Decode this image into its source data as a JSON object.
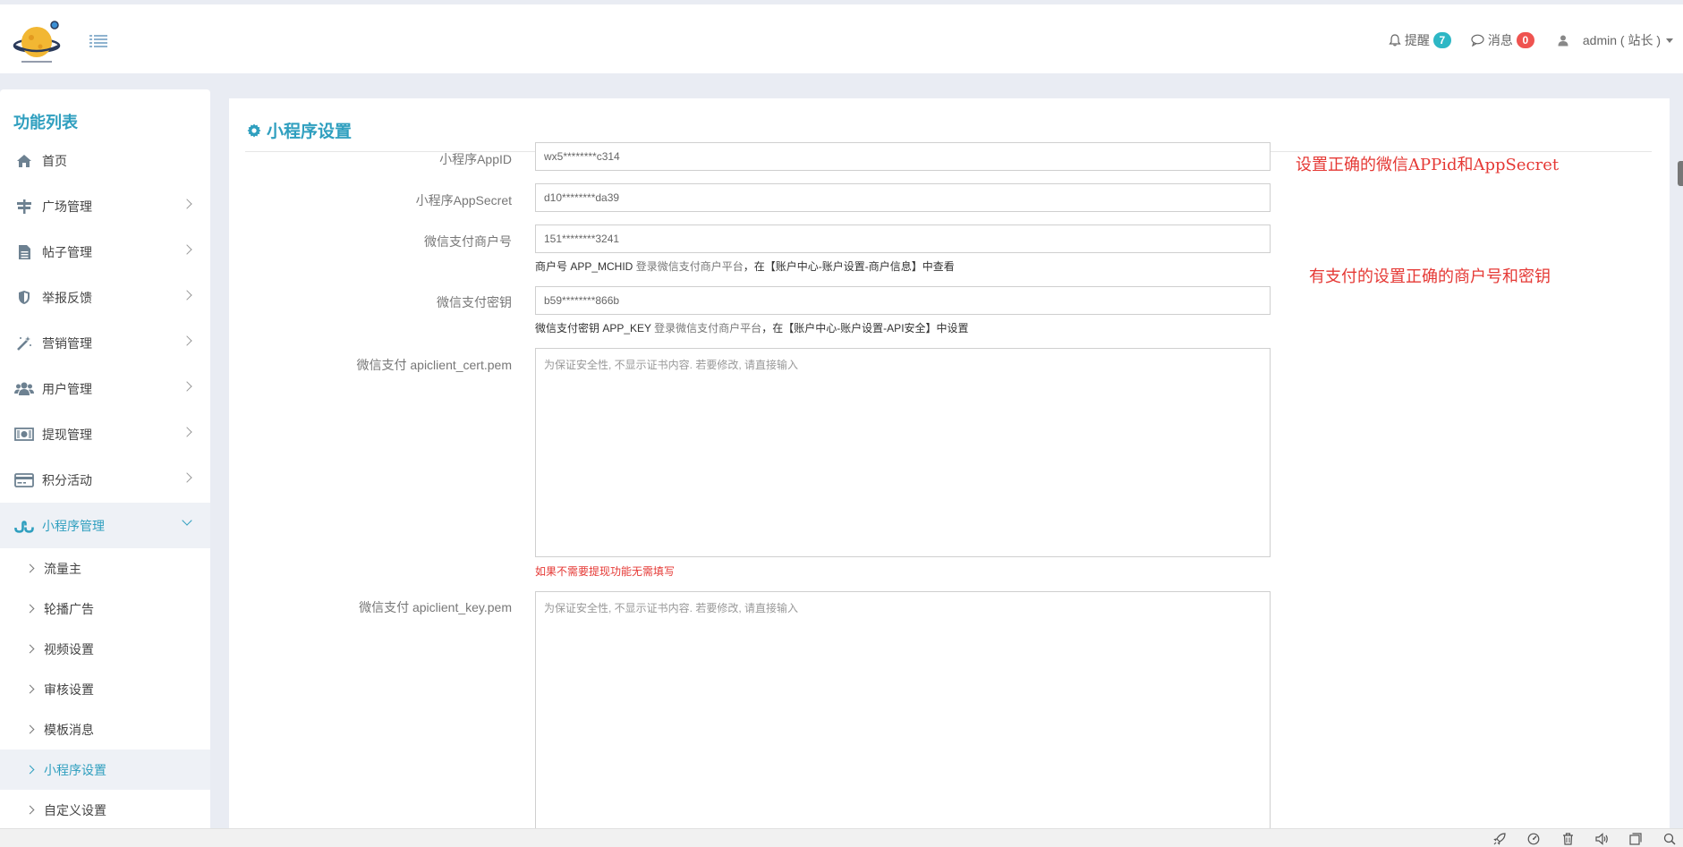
{
  "header": {
    "reminder_label": "提醒",
    "reminder_count": "7",
    "message_label": "消息",
    "message_count": "0",
    "user_label": "admin ( 站长 )"
  },
  "sidebar": {
    "title": "功能列表",
    "items": [
      {
        "label": "首页",
        "icon": "home-icon"
      },
      {
        "label": "广场管理",
        "icon": "signpost-icon"
      },
      {
        "label": "帖子管理",
        "icon": "file-icon"
      },
      {
        "label": "举报反馈",
        "icon": "shield-icon"
      },
      {
        "label": "营销管理",
        "icon": "magic-wand-icon"
      },
      {
        "label": "用户管理",
        "icon": "users-icon"
      },
      {
        "label": "提现管理",
        "icon": "money-icon"
      },
      {
        "label": "积分活动",
        "icon": "credit-card-icon"
      },
      {
        "label": "小程序管理",
        "icon": "stumbleupon-icon"
      }
    ],
    "sub_items": [
      {
        "label": "流量主"
      },
      {
        "label": "轮播广告"
      },
      {
        "label": "视频设置"
      },
      {
        "label": "审核设置"
      },
      {
        "label": "模板消息"
      },
      {
        "label": "小程序设置"
      },
      {
        "label": "自定义设置"
      }
    ]
  },
  "main": {
    "title": "小程序设置",
    "fields": {
      "appid_label": "小程序AppID",
      "appid_value": "wx5********c314",
      "appsecret_label": "小程序AppSecret",
      "appsecret_value": "d10********da39",
      "mchid_label": "微信支付商户号",
      "mchid_value": "151********3241",
      "mchid_help_prefix": "商户号 APP_MCHID",
      "mchid_help_link": "登录微信支付商户平台",
      "mchid_help_suffix": "，在【账户中心-账户设置-商户信息】中查看",
      "key_label": "微信支付密钥",
      "key_value": "b59********866b",
      "key_help_prefix": "微信支付密钥 APP_KEY",
      "key_help_link": "登录微信支付商户平台",
      "key_help_suffix": "，在【账户中心-账户设置-API安全】中设置",
      "cert_label": "微信支付 apiclient_cert.pem",
      "cert_placeholder": "为保证安全性, 不显示证书内容. 若要修改, 请直接输入",
      "cert_warning": "如果不需要提现功能无需填写",
      "keypem_label": "微信支付 apiclient_key.pem",
      "keypem_placeholder": "为保证安全性, 不显示证书内容. 若要修改, 请直接输入"
    },
    "notes": {
      "note1": "设置正确的微信APPid和AppSecret",
      "note2": "有支付的设置正确的商户号和密钥"
    }
  },
  "colors": {
    "accent": "#2f9fbf",
    "badge_teal": "#2db7c5",
    "badge_red": "#ef5350",
    "warning": "#e53935"
  }
}
